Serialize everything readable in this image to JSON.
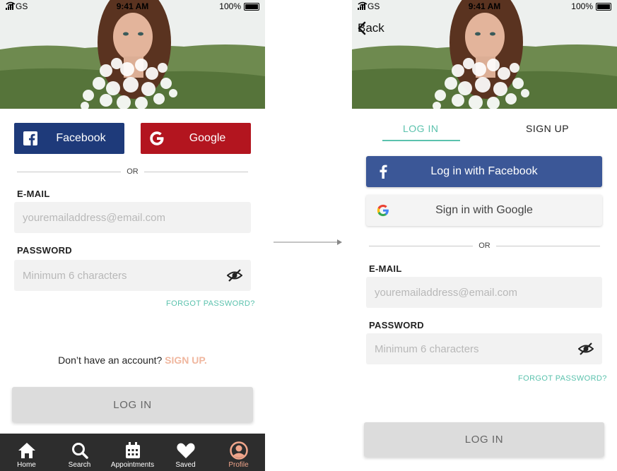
{
  "status_bar": {
    "carrier": "GS",
    "time": "9:41 AM",
    "battery": "100%"
  },
  "left_screen": {
    "facebook_label": "Facebook",
    "google_label": "Google",
    "divider": "OR",
    "email_label": "E-MAIL",
    "email_placeholder": "youremailaddress@email.com",
    "password_label": "PASSWORD",
    "password_placeholder": "Minimum 6 characters",
    "forgot_password": "FORGOT PASSWORD?",
    "no_account_text": "Don’t have an account?",
    "sign_up_link": "SIGN UP.",
    "login_button": "LOG IN",
    "tabbar": [
      {
        "label": "Home",
        "icon": "home-icon"
      },
      {
        "label": "Search",
        "icon": "search-icon"
      },
      {
        "label": "Appointments",
        "icon": "calendar-icon"
      },
      {
        "label": "Saved",
        "icon": "heart-icon"
      },
      {
        "label": "Profile",
        "icon": "profile-icon"
      }
    ]
  },
  "right_screen": {
    "back_label": "Back",
    "tab_login": "LOG IN",
    "tab_signup": "SIGN UP",
    "facebook_button": "Log in with Facebook",
    "google_button": "Sign in with Google",
    "divider": "OR",
    "email_label": "E-MAIL",
    "email_placeholder": "youremailaddress@email.com",
    "password_label": "PASSWORD",
    "password_placeholder": "Minimum 6 characters",
    "forgot_password": "FORGOT PASSWORD?",
    "login_button": "LOG IN"
  },
  "colors": {
    "facebook_dark": "#1e3a7a",
    "facebook": "#3b5797",
    "google_red": "#b3151f",
    "accent_teal": "#5bc2ad",
    "accent_peach": "#f0b79f",
    "tabbar_bg": "#2d2d2d"
  }
}
